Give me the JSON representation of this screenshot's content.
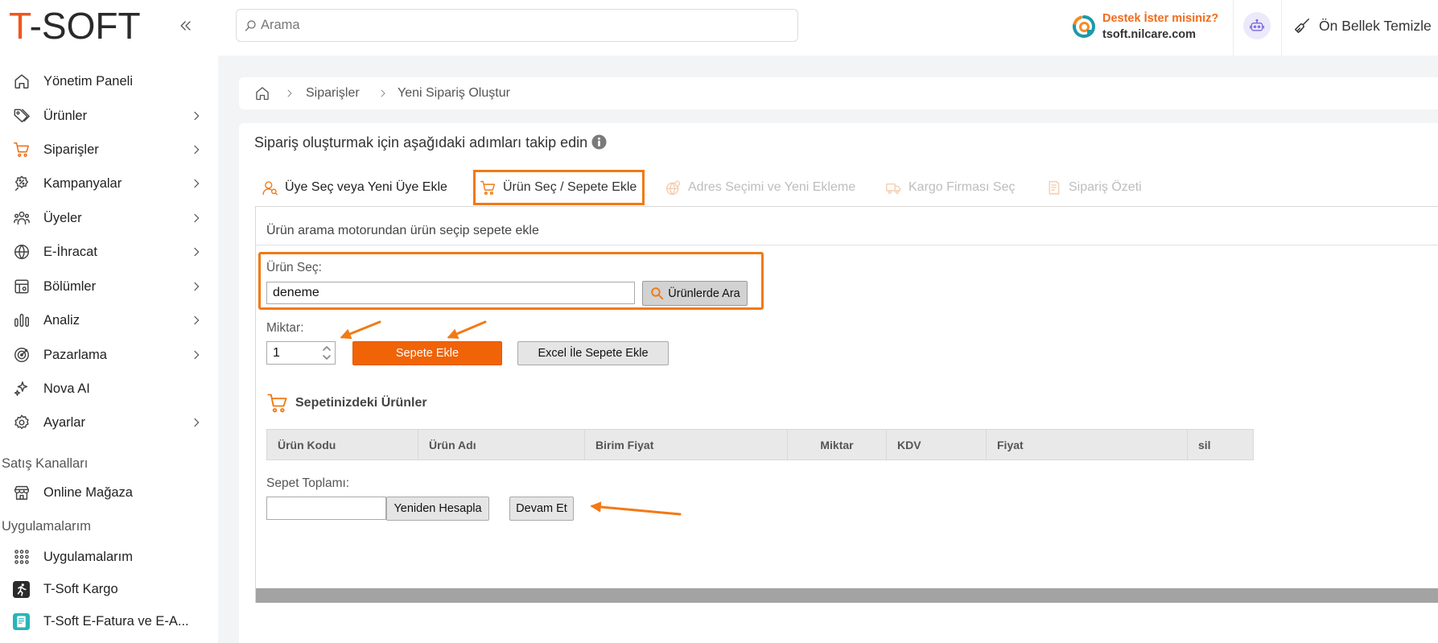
{
  "header": {
    "logo_accent": "T",
    "logo_rest": "-SOFT",
    "search_placeholder": "Arama",
    "support_title": "Destek İster misiniz?",
    "support_domain": "tsoft.nilcare.com",
    "cache_button": "Ön Bellek Temizle"
  },
  "sidebar": {
    "items": [
      {
        "label": "Yönetim Paneli",
        "icon": "home-icon",
        "has_submenu": false
      },
      {
        "label": "Ürünler",
        "icon": "tag-icon",
        "has_submenu": true
      },
      {
        "label": "Siparişler",
        "icon": "cart-icon",
        "has_submenu": true,
        "active": true
      },
      {
        "label": "Kampanyalar",
        "icon": "discount-icon",
        "has_submenu": true
      },
      {
        "label": "Üyeler",
        "icon": "users-icon",
        "has_submenu": true
      },
      {
        "label": "E-İhracat",
        "icon": "globe-icon",
        "has_submenu": true
      },
      {
        "label": "Bölümler",
        "icon": "layout-icon",
        "has_submenu": true
      },
      {
        "label": "Analiz",
        "icon": "chart-icon",
        "has_submenu": true
      },
      {
        "label": "Pazarlama",
        "icon": "target-icon",
        "has_submenu": true
      },
      {
        "label": "Nova AI",
        "icon": "sparkle-icon",
        "has_submenu": false
      },
      {
        "label": "Ayarlar",
        "icon": "gear-icon",
        "has_submenu": true
      }
    ],
    "sections": [
      {
        "title": "Satış Kanalları",
        "items": [
          {
            "label": "Online Mağaza",
            "icon": "store-icon"
          }
        ]
      },
      {
        "title": "Uygulamalarım",
        "items": [
          {
            "label": "Uygulamalarım",
            "icon": "apps-grid-icon"
          },
          {
            "label": "T-Soft Kargo",
            "icon": "tsoft-kargo-app-icon"
          },
          {
            "label": "T-Soft E-Fatura ve E-A...",
            "icon": "tsoft-efatura-app-icon"
          }
        ]
      }
    ]
  },
  "breadcrumb": {
    "items": [
      "Siparişler",
      "Yeni Sipariş Oluştur"
    ]
  },
  "steps": {
    "title": "Sipariş oluşturmak için aşağıdaki adımları takip edin",
    "tabs": [
      {
        "label": "Üye Seç veya Yeni Üye Ekle",
        "icon": "user-search-icon",
        "state": "enabled"
      },
      {
        "label": "Ürün Seç / Sepete Ekle",
        "icon": "cart-icon",
        "state": "active"
      },
      {
        "label": "Adres Seçimi ve Yeni Ekleme",
        "icon": "address-icon",
        "state": "disabled"
      },
      {
        "label": "Kargo Firması Seç",
        "icon": "truck-icon",
        "state": "disabled"
      },
      {
        "label": "Sipariş Özeti",
        "icon": "receipt-icon",
        "state": "disabled"
      }
    ]
  },
  "panel": {
    "subtitle": "Ürün arama motorundan ürün seçip sepete ekle",
    "product_label": "Ürün Seç:",
    "product_value": "deneme",
    "search_button": "Ürünlerde Ara",
    "quantity_label": "Miktar:",
    "quantity_value": "1",
    "add_button": "Sepete Ekle",
    "excel_button": "Excel İle Sepete Ekle",
    "cart_title": "Sepetinizdeki Ürünler",
    "cart_table": {
      "columns": [
        "Ürün Kodu",
        "Ürün Adı",
        "Birim Fiyat",
        "Miktar",
        "KDV",
        "Fiyat",
        "sil"
      ],
      "rows": []
    },
    "total_label": "Sepet Toplamı:",
    "total_value": "",
    "recalc_button": "Yeniden Hesapla",
    "continue_button": "Devam Et"
  },
  "colors": {
    "accent": "#f06307",
    "highlight_border": "#f07a14",
    "disabled_text": "#bdbdbd",
    "support_title": "#f26b1d"
  }
}
